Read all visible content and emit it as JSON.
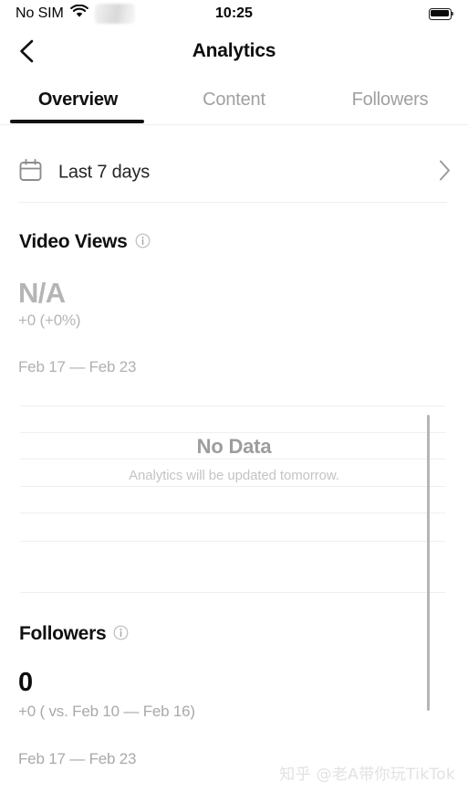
{
  "status_bar": {
    "carrier": "No SIM",
    "time": "10:25",
    "wifi_icon": "wifi-icon",
    "redacted_icon": "blurred-redacted-badge",
    "battery_icon": "battery-full-icon"
  },
  "header": {
    "back_icon": "chevron-left-icon",
    "title": "Analytics"
  },
  "tabs": {
    "items": [
      {
        "label": "Overview",
        "active": true
      },
      {
        "label": "Content",
        "active": false
      },
      {
        "label": "Followers",
        "active": false
      }
    ]
  },
  "date_range_row": {
    "calendar_icon": "calendar-icon",
    "label": "Last 7 days",
    "chevron_icon": "chevron-right-icon"
  },
  "video_views": {
    "title": "Video Views",
    "info_icon": "info-circle-icon",
    "value": "N/A",
    "delta": "+0 (+0%)",
    "range": "Feb 17 — Feb 23",
    "empty_title": "No Data",
    "empty_subtitle": "Analytics will be updated tomorrow."
  },
  "followers": {
    "title": "Followers",
    "info_icon": "info-circle-icon",
    "value": "0",
    "delta": "+0 ( vs. Feb 10 — Feb 16)",
    "range": "Feb 17 — Feb 23"
  },
  "watermark": {
    "text": "知乎 @老A带你玩TikTok"
  },
  "colors": {
    "accent": "#111111",
    "text_primary": "#101010",
    "text_muted": "#b0b0b0",
    "divider": "#efefef",
    "scrollbar": "#b6b6b6"
  },
  "chart_data": {
    "type": "line",
    "title": "Video Views",
    "xlabel": "",
    "ylabel": "",
    "categories": [],
    "values": [],
    "series": [],
    "gridlines_y": [
      444,
      473,
      502,
      532,
      561,
      592
    ],
    "grid": true,
    "legend": "none",
    "empty_state": "No Data",
    "empty_note": "Analytics will be updated tomorrow.",
    "date_range": "Feb 17 — Feb 23"
  }
}
